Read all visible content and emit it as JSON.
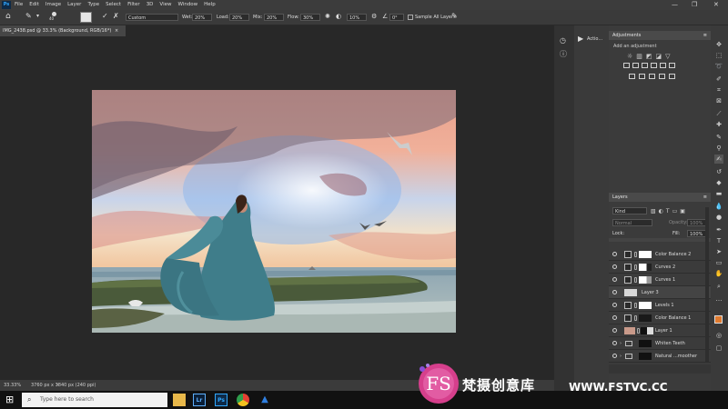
{
  "menu": {
    "ps": "Ps",
    "items": [
      "File",
      "Edit",
      "Image",
      "Layer",
      "Type",
      "Select",
      "Filter",
      "3D",
      "View",
      "Window",
      "Help"
    ]
  },
  "window": {
    "minimize": "—",
    "restore": "❐",
    "close": "✕"
  },
  "options": {
    "brush_size": "40",
    "mode": "Custom",
    "wet_label": "Wet:",
    "wet": "20%",
    "load_label": "Load:",
    "load": "20%",
    "mix_label": "Mix:",
    "mix": "20%",
    "flow_label": "Flow:",
    "flow": "30%",
    "smoothing": "10%",
    "angle": "0°",
    "sample_all_layers": "Sample All Layers"
  },
  "document": {
    "tab": "IMG_2438.psd @ 33.3% (Background, RGB/16*)",
    "tab_close": "×"
  },
  "status": {
    "zoom": "33.33%",
    "info": "3760 px x 3840 px (240 ppi)"
  },
  "actions": {
    "title": "Actio..."
  },
  "adjustments": {
    "title": "Adjustments",
    "subtitle": "Add an adjustment"
  },
  "layers": {
    "title": "Layers",
    "kind": "Kind",
    "blend": "Normal",
    "opacity_label": "Opacity:",
    "opacity": "100%",
    "lock_label": "Lock:",
    "fill_label": "Fill:",
    "fill": "100%",
    "items": [
      {
        "name": "Color Balance 2"
      },
      {
        "name": "Curves 2"
      },
      {
        "name": "Curves 1"
      },
      {
        "name": "Layer 3"
      },
      {
        "name": "Levels 1"
      },
      {
        "name": "Color Balance 1"
      },
      {
        "name": "Layer 1"
      },
      {
        "name": "Whiten Teeth"
      },
      {
        "name": "Natural ...moother"
      }
    ]
  },
  "taskbar": {
    "search_placeholder": "Type here to search",
    "apps": [
      "Lr",
      "Ps"
    ]
  },
  "watermark": {
    "logo": "FS",
    "text": "梵摄创意库",
    "url": "WWW.FSTVC.CC"
  },
  "colors": {
    "foreground": "#e07a2e",
    "background": "#ffffff",
    "accent": "#31a8ff"
  }
}
